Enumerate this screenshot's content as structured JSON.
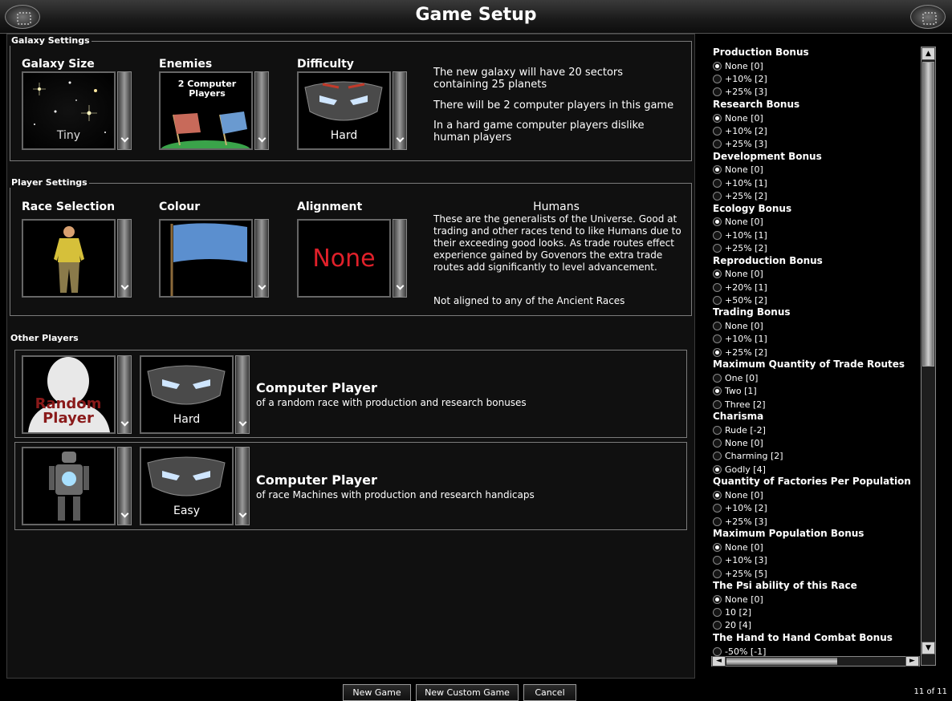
{
  "window": {
    "title": "Game Setup"
  },
  "galaxy": {
    "group_label": "Galaxy Settings",
    "size": {
      "header": "Galaxy Size",
      "value": "Tiny"
    },
    "enemies": {
      "header": "Enemies",
      "value": "2 Computer Players"
    },
    "difficulty": {
      "header": "Difficulty",
      "value": "Hard"
    },
    "description": [
      "The new galaxy will have 20 sectors containing 25 planets",
      "There will be 2 computer players in this game",
      "In a hard game computer players dislike human players"
    ]
  },
  "player": {
    "group_label": "Player Settings",
    "race": {
      "header": "Race Selection"
    },
    "colour": {
      "header": "Colour",
      "value": "#5b8fcf"
    },
    "alignment": {
      "header": "Alignment",
      "value": "None"
    },
    "race_name": "Humans",
    "race_description": "These are the generalists of the Universe. Good at trading and other races tend to like Humans due to their exceeding good looks. As trade routes effect experience gained by Govenors the extra trade routes add significantly to level advancement.",
    "alignment_description": "Not aligned to any of the Ancient Races"
  },
  "others": {
    "group_label": "Other Players",
    "players": [
      {
        "portrait_label": "Random Player",
        "difficulty": "Hard",
        "title": "Computer Player",
        "subtitle": "of a random race with production and research bonuses"
      },
      {
        "portrait_label": "",
        "difficulty": "Easy",
        "title": "Computer Player",
        "subtitle": "of race Machines with production and research handicaps"
      }
    ]
  },
  "bonuses": [
    {
      "title": "Production Bonus",
      "options": [
        "None [0]",
        "+10% [2]",
        "+25% [3]"
      ],
      "selected": 0
    },
    {
      "title": "Research Bonus",
      "options": [
        "None [0]",
        "+10% [2]",
        "+25% [3]"
      ],
      "selected": 0
    },
    {
      "title": "Development Bonus",
      "options": [
        "None [0]",
        "+10% [1]",
        "+25% [2]"
      ],
      "selected": 0
    },
    {
      "title": "Ecology Bonus",
      "options": [
        "None [0]",
        "+10% [1]",
        "+25% [2]"
      ],
      "selected": 0
    },
    {
      "title": "Reproduction Bonus",
      "options": [
        "None [0]",
        "+20% [1]",
        "+50% [2]"
      ],
      "selected": 0
    },
    {
      "title": "Trading Bonus",
      "options": [
        "None [0]",
        "+10% [1]",
        "+25% [2]"
      ],
      "selected": 2
    },
    {
      "title": "Maximum Quantity of Trade Routes",
      "options": [
        "One [0]",
        "Two [1]",
        "Three [2]"
      ],
      "selected": 1
    },
    {
      "title": "Charisma",
      "options": [
        "Rude [-2]",
        "None [0]",
        "Charming [2]",
        "Godly [4]"
      ],
      "selected": 3
    },
    {
      "title": "Quantity of Factories Per Population",
      "options": [
        "None [0]",
        "+10% [2]",
        "+25% [3]"
      ],
      "selected": 0
    },
    {
      "title": "Maximum Population Bonus",
      "options": [
        "None [0]",
        "+10% [3]",
        "+25% [5]"
      ],
      "selected": 0
    },
    {
      "title": "The Psi ability of this Race",
      "options": [
        "None [0]",
        "10 [2]",
        "20 [4]"
      ],
      "selected": 0
    },
    {
      "title": "The Hand to Hand Combat Bonus",
      "options": [
        "-50% [-1]"
      ],
      "selected": -1
    }
  ],
  "buttons": {
    "new_game": "New Game",
    "new_custom_game": "New Custom Game",
    "cancel": "Cancel"
  },
  "page_count": "11 of 11"
}
